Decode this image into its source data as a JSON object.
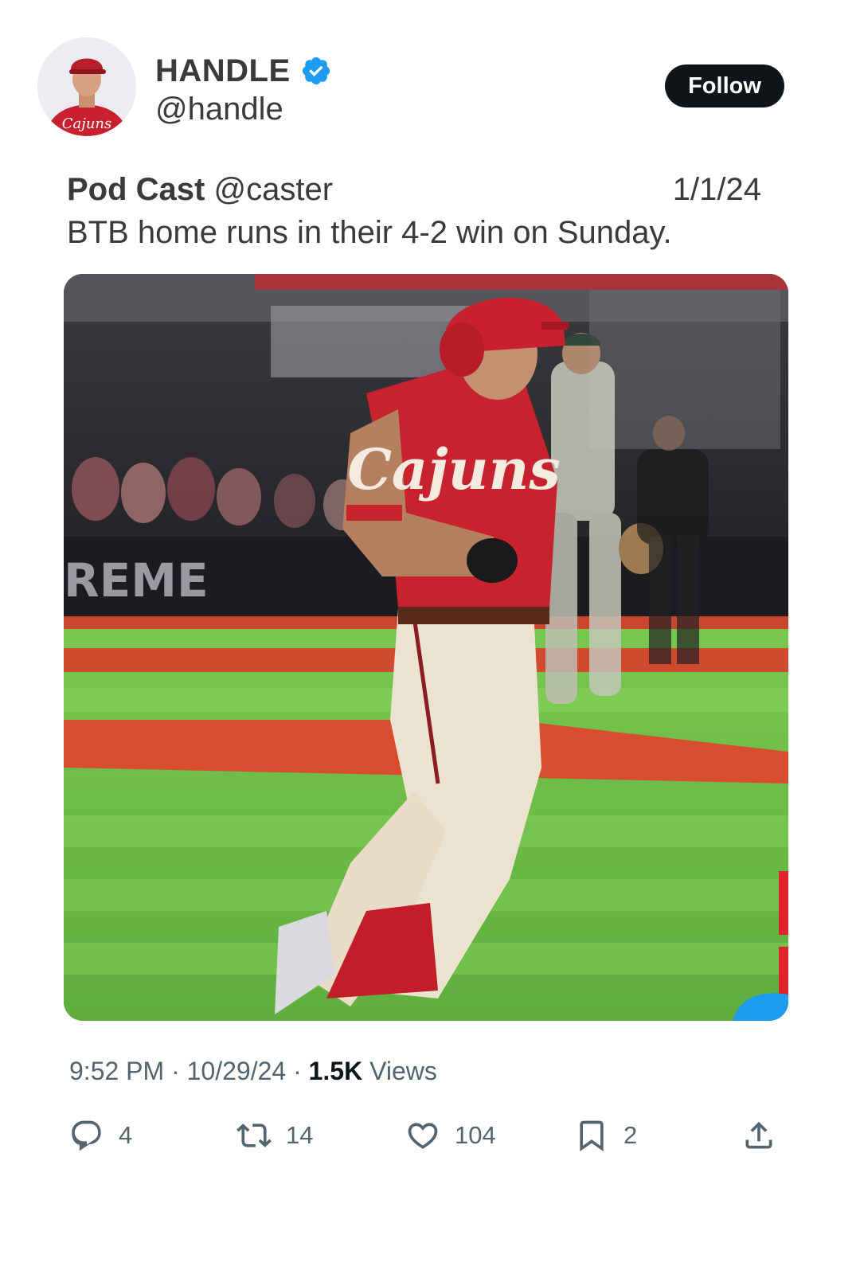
{
  "user": {
    "display_name": "HANDLE",
    "handle": "@handle",
    "verified_icon": "verified-badge-icon",
    "follow_label": "Follow",
    "accent": "#1d9bf0"
  },
  "quote": {
    "author_name": "Pod Cast",
    "author_handle": "@caster",
    "date": "1/1/24",
    "text": "BTB home runs in their 4-2 win on Sunday."
  },
  "media": {
    "fence_text": "REME",
    "jersey_text": "Cajuns"
  },
  "meta": {
    "time": "9:52 PM",
    "sep1": " · ",
    "date": "10/29/24",
    "sep2": " · ",
    "views_count": "1.5K",
    "views_label": " Views"
  },
  "actions": {
    "replies": "4",
    "reposts": "14",
    "likes": "104",
    "bookmarks": "2"
  }
}
